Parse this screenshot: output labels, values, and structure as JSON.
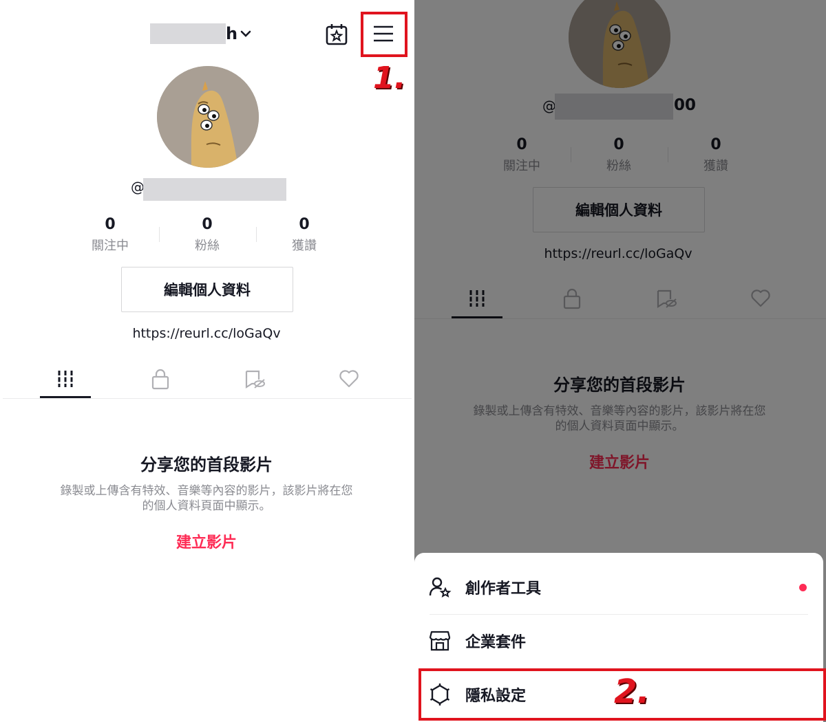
{
  "left": {
    "header": {
      "username_suffix": "h",
      "chevron": "chevron-down-icon",
      "calendar_icon": "calendar-star-icon",
      "menu_icon": "hamburger-menu-icon"
    },
    "profile": {
      "handle_prefix": "@"
    },
    "stats": [
      {
        "value": "0",
        "label": "關注中"
      },
      {
        "value": "0",
        "label": "粉絲"
      },
      {
        "value": "0",
        "label": "獲讚"
      }
    ],
    "edit_button": "編輯個人資料",
    "bio_link": "https://reurl.cc/loGaQv",
    "tabs": [
      {
        "icon": "grid-videos-icon"
      },
      {
        "icon": "lock-icon"
      },
      {
        "icon": "hidden-tag-icon"
      },
      {
        "icon": "heart-icon"
      }
    ],
    "empty_state": {
      "title": "分享您的首段影片",
      "desc_line1": "錄製或上傳含有特效、音樂等內容的影片，該影片將在您",
      "desc_line2": "的個人資料頁面中顯示。",
      "cta": "建立影片"
    }
  },
  "right": {
    "profile": {
      "handle_prefix": "@",
      "handle_suffix": "00"
    },
    "stats": [
      {
        "value": "0",
        "label": "關注中"
      },
      {
        "value": "0",
        "label": "粉絲"
      },
      {
        "value": "0",
        "label": "獲讚"
      }
    ],
    "edit_button": "編輯個人資料",
    "bio_link": "https://reurl.cc/loGaQv",
    "empty_state": {
      "title": "分享您的首段影片",
      "desc_line1": "錄製或上傳含有特效、音樂等內容的影片，該影片將在您",
      "desc_line2": "的個人資料頁面中顯示。",
      "cta": "建立影片"
    },
    "menu": [
      {
        "label": "創作者工具",
        "icon": "creator-tools-icon",
        "badge": true
      },
      {
        "label": "企業套件",
        "icon": "storefront-icon",
        "badge": false
      },
      {
        "label": "隱私設定",
        "icon": "privacy-settings-icon",
        "badge": false
      }
    ]
  },
  "annotations": {
    "step1": "1.",
    "step2": "2."
  },
  "colors": {
    "accent": "#fe2c55",
    "annotation": "#e0141e",
    "text": "#161823",
    "muted": "#8a8b91"
  }
}
